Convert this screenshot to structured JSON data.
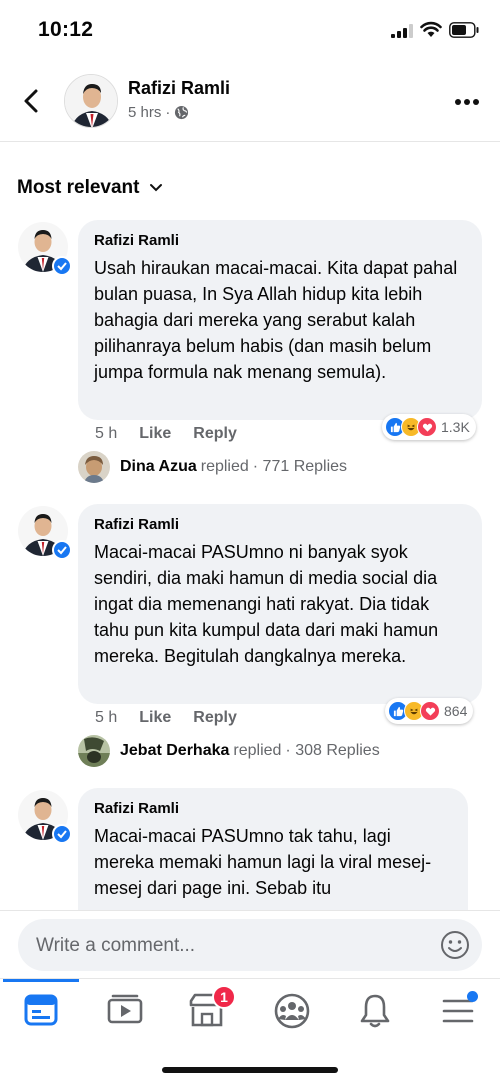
{
  "status_bar": {
    "time": "10:12"
  },
  "post_header": {
    "author": "Rafizi Ramli",
    "time": "5 hrs",
    "separator": "·"
  },
  "filter": {
    "label": "Most relevant"
  },
  "comments": [
    {
      "author": "Rafizi Ramli",
      "text": "Usah hiraukan macai-macai. Kita dapat pahal bulan puasa, In Sya Allah hidup kita lebih bahagia dari mereka yang serabut kalah pilihanraya belum habis (dan masih belum jumpa formula nak menang semula).",
      "time": "5 h",
      "like": "Like",
      "reply": "Reply",
      "reaction_count": "1.3K",
      "reply_author": "Dina Azua",
      "reply_verb": "replied",
      "reply_count": "· 771 Replies"
    },
    {
      "author": "Rafizi Ramli",
      "text": "Macai-macai PASUmno ni banyak syok sendiri, dia maki hamun di media social dia ingat dia memenangi hati rakyat. Dia tidak tahu pun kita kumpul data dari maki hamun mereka. Begitulah dangkalnya mereka.",
      "time": "5 h",
      "like": "Like",
      "reply": "Reply",
      "reaction_count": "864",
      "reply_author": "Jebat Derhaka",
      "reply_verb": "replied",
      "reply_count": "· 308 Replies"
    },
    {
      "author": "Rafizi Ramli",
      "text": "Macai-macai PASUmno tak tahu, lagi mereka memaki hamun lagi la viral mesej-mesej dari page ini. Sebab itu"
    }
  ],
  "composer": {
    "placeholder": "Write a comment..."
  },
  "tabbar": {
    "marketplace_badge": "1"
  },
  "colors": {
    "accent": "#1877f2",
    "bubble": "#f0f2f5",
    "badge": "#f02849"
  }
}
